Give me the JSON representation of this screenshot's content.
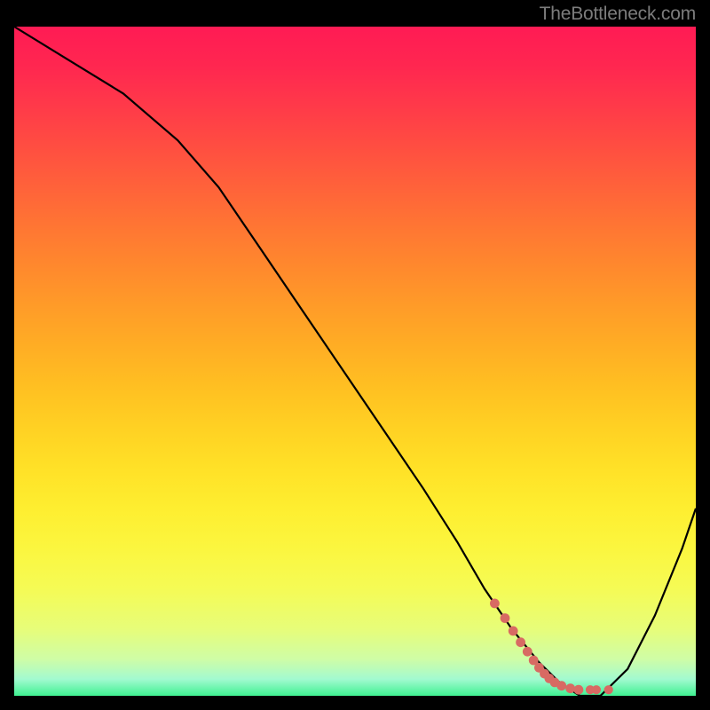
{
  "watermark": "TheBottleneck.com",
  "gradient": {
    "stops": [
      {
        "offset": 0.0,
        "color": "#ff1b54"
      },
      {
        "offset": 0.06,
        "color": "#ff2750"
      },
      {
        "offset": 0.12,
        "color": "#ff3a49"
      },
      {
        "offset": 0.18,
        "color": "#ff4e41"
      },
      {
        "offset": 0.24,
        "color": "#ff623a"
      },
      {
        "offset": 0.3,
        "color": "#ff7633"
      },
      {
        "offset": 0.36,
        "color": "#ff892d"
      },
      {
        "offset": 0.42,
        "color": "#ff9c28"
      },
      {
        "offset": 0.48,
        "color": "#ffae24"
      },
      {
        "offset": 0.54,
        "color": "#ffc022"
      },
      {
        "offset": 0.6,
        "color": "#ffd123"
      },
      {
        "offset": 0.66,
        "color": "#ffe127"
      },
      {
        "offset": 0.72,
        "color": "#feee30"
      },
      {
        "offset": 0.78,
        "color": "#fbf63f"
      },
      {
        "offset": 0.84,
        "color": "#f5fb55"
      },
      {
        "offset": 0.9,
        "color": "#e7fd79"
      },
      {
        "offset": 0.945,
        "color": "#cffda6"
      },
      {
        "offset": 0.975,
        "color": "#a3fad0"
      },
      {
        "offset": 1.0,
        "color": "#3ff191"
      }
    ]
  },
  "chart_data": {
    "type": "line",
    "title": "",
    "xlabel": "",
    "ylabel": "",
    "xlim": [
      0,
      100
    ],
    "ylim": [
      0,
      100
    ],
    "series": [
      {
        "name": "curve",
        "x": [
          0,
          8,
          16,
          24,
          30,
          36,
          42,
          48,
          54,
          60,
          65,
          69,
          73,
          77,
          80,
          83,
          86,
          90,
          94,
          98,
          100
        ],
        "y": [
          100,
          95,
          90,
          83,
          76,
          67,
          58,
          49,
          40,
          31,
          23,
          16,
          10,
          5,
          2,
          0,
          0,
          4,
          12,
          22,
          28
        ]
      }
    ],
    "dots": {
      "name": "highlight",
      "x": [
        70.5,
        72.0,
        73.2,
        74.3,
        75.3,
        76.2,
        77.0,
        77.8,
        78.5,
        79.3,
        80.3,
        81.6,
        82.8,
        84.5,
        85.4,
        87.2
      ],
      "y": [
        13.8,
        11.6,
        9.7,
        8.0,
        6.6,
        5.3,
        4.2,
        3.3,
        2.6,
        2.0,
        1.5,
        1.1,
        0.9,
        0.9,
        0.9,
        0.9
      ],
      "r": [
        5.4,
        5.4,
        5.4,
        5.4,
        5.4,
        5.4,
        5.4,
        5.4,
        5.4,
        5.4,
        5.4,
        5.4,
        5.4,
        5.1,
        5.1,
        5.1
      ]
    }
  }
}
